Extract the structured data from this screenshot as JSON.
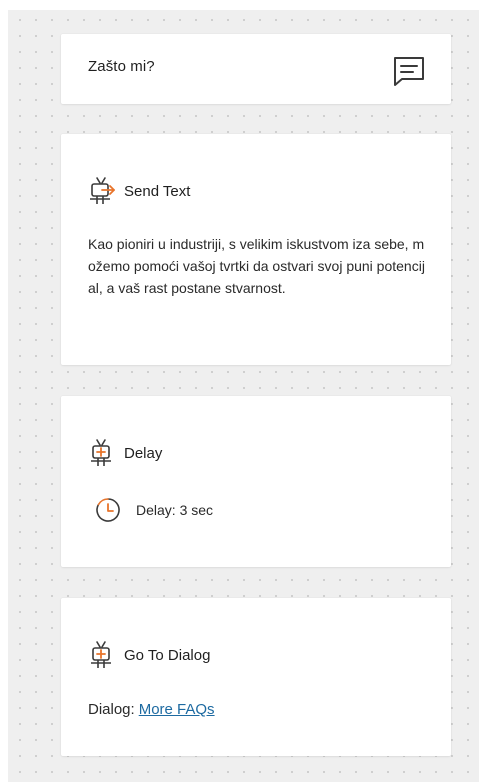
{
  "title_card": {
    "title": "Zašto mi?",
    "icon": "comment-icon"
  },
  "send_text_node": {
    "title": "Send Text",
    "icon": "send-text-node-icon",
    "body": "Kao pioniri u industriji, s velikim iskustvom iza sebe, možemo pomoći vašoj tvrtki da ostvari svoj puni potencijal, a vaš rast postane stvarnost."
  },
  "delay_node": {
    "title": "Delay",
    "icon": "delay-node-icon",
    "clock_icon": "clock-icon",
    "delay_text": "Delay: 3 sec"
  },
  "goto_dialog_node": {
    "title": "Go To Dialog",
    "icon": "goto-dialog-node-icon",
    "dialog_label": "Dialog:",
    "dialog_link": "More FAQs"
  },
  "colors": {
    "canvas": "#efefef",
    "card": "#ffffff",
    "accent_orange": "#e8742b",
    "link": "#1d6aa1",
    "icon_dark": "#3a3a3a"
  }
}
